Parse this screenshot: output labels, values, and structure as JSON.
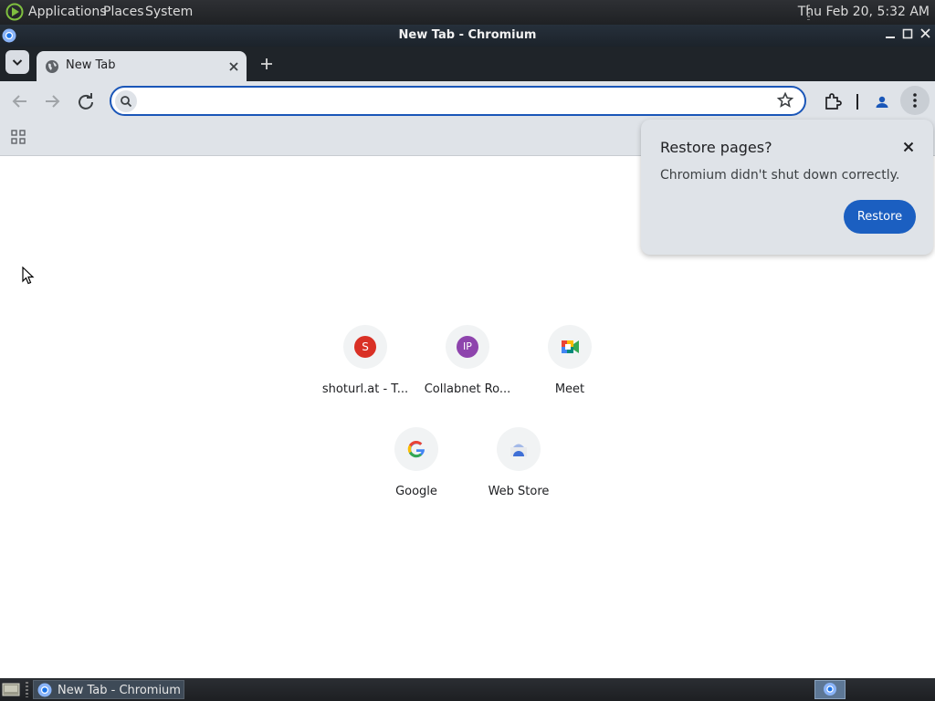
{
  "panel": {
    "menus": [
      "Applications",
      "Places",
      "System"
    ],
    "clock": "Thu Feb 20,  5:32 AM"
  },
  "window": {
    "title": "New Tab - Chromium",
    "controls": [
      "minimize",
      "maximize",
      "close"
    ]
  },
  "tabs": [
    {
      "title": "New Tab",
      "icon": "globe-icon",
      "active": true
    }
  ],
  "toolbar": {
    "omnibox_value": "",
    "omnibox_placeholder": ""
  },
  "restore_bubble": {
    "title": "Restore pages?",
    "message": "Chromium didn't shut down correctly.",
    "button": "Restore"
  },
  "shortcuts": [
    {
      "label": "shoturl.at - T...",
      "icon_text": "S",
      "color": "#d93025"
    },
    {
      "label": "Collabnet Ro...",
      "icon_text": "IP",
      "color": "#8e44ad"
    },
    {
      "label": "Meet",
      "icon_text": "",
      "color": "#00897b"
    },
    {
      "label": "Google",
      "icon_text": "G",
      "color": "#4285f4"
    },
    {
      "label": "Web Store",
      "icon_text": "",
      "color": "#4f7fe0"
    }
  ],
  "taskbar": {
    "task_label": "New Tab - Chromium"
  },
  "colors": {
    "accent": "#1b5fc1",
    "omnibox_border": "#1a56b8",
    "toolbar_bg": "#dfe3e8"
  }
}
